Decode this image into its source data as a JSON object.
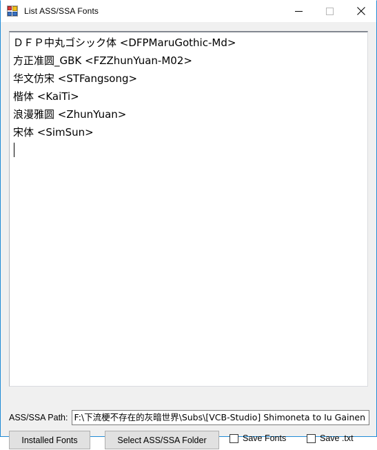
{
  "window": {
    "title": "List ASS/SSA Fonts",
    "icon": "application-window-icon",
    "accent_color": "#1e8ad6",
    "client_bg": "#f0f0f0",
    "controls": {
      "minimize_label": "Minimize",
      "maximize_label": "Maximize",
      "close_label": "Close"
    }
  },
  "font_list": {
    "lines": [
      "ＤＦＰ中丸ゴシック体 <DFPMaruGothic-Md>",
      "方正准圆_GBK <FZZhunYuan-M02>",
      "华文仿宋 <STFangsong>",
      "楷体 <KaiTi>",
      "浪漫雅圆 <ZhunYuan>",
      "宋体 <SimSun>"
    ],
    "caret_after_last_line": true
  },
  "path_row": {
    "label": "ASS/SSA Path:",
    "value": "F:\\下流梗不存在的灰暗世界\\Subs\\[VCB-Studio] Shimoneta to Iu Gainen",
    "placeholder": ""
  },
  "buttons": {
    "installed_fonts": "Installed Fonts",
    "select_folder": "Select ASS/SSA Folder"
  },
  "checkboxes": [
    {
      "label": "Save Fonts",
      "checked": false
    },
    {
      "label": "Save .txt",
      "checked": false
    }
  ]
}
